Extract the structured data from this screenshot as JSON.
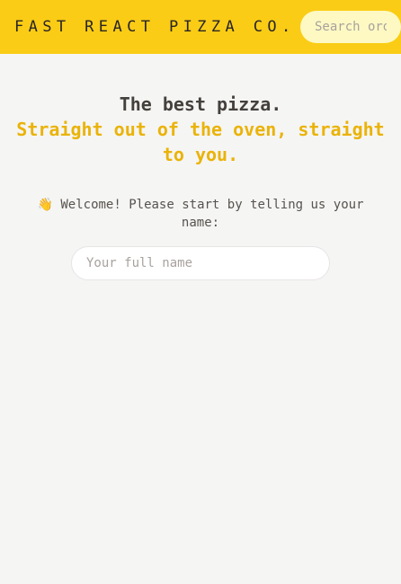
{
  "header": {
    "logo": "FAST REACT PIZZA CO.",
    "search_placeholder": "Search order #"
  },
  "home": {
    "title": "The best pizza.",
    "tagline": "Straight out of the oven, straight to you.",
    "welcome_icon": "waving-hand-icon",
    "welcome_emoji": "👋",
    "welcome_text": "Welcome! Please start by telling us your name:",
    "name_placeholder": "Your full name"
  },
  "colors": {
    "header_bg": "#facc15",
    "accent": "#eab308",
    "page_bg": "#f5f5f4"
  }
}
